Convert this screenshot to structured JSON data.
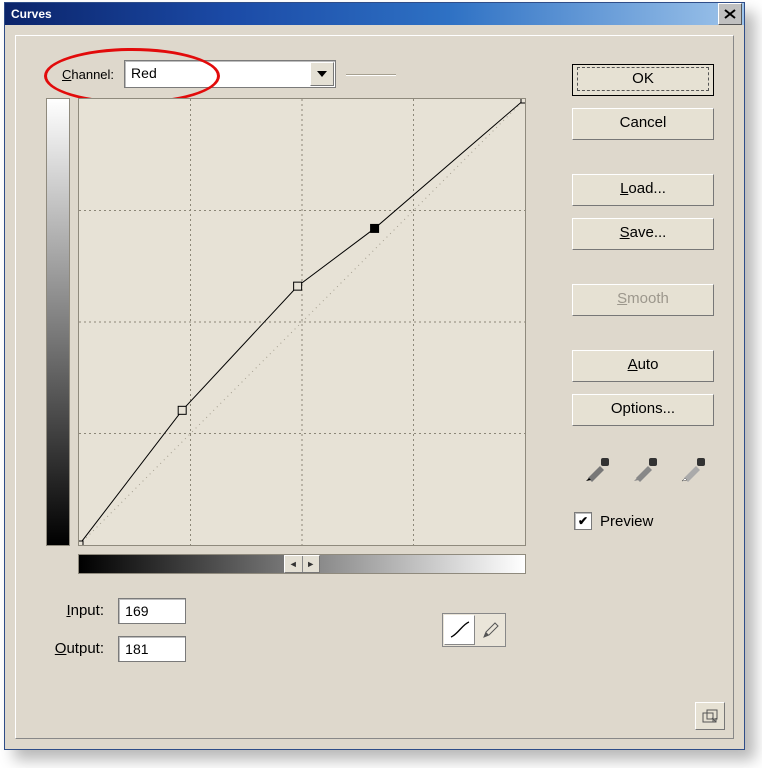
{
  "title": "Curves",
  "channel": {
    "label_pre": "C",
    "label_rest": "hannel:",
    "value": "Red"
  },
  "io": {
    "input_label_pre": "I",
    "input_label_rest": "nput:",
    "input_value": "169",
    "output_label_pre": "O",
    "output_label_rest": "utput:",
    "output_value": "181"
  },
  "buttons": {
    "ok": "OK",
    "cancel": "Cancel",
    "load_pre": "L",
    "load_rest": "oad...",
    "save_pre": "S",
    "save_rest": "ave...",
    "smooth_pre": "S",
    "smooth_rest": "mooth",
    "auto_pre": "A",
    "auto_rest": "uto",
    "options": "Options..."
  },
  "preview": {
    "checked": "✔",
    "label_pre": "P",
    "label_rest": "review"
  },
  "curve": {
    "points": [
      {
        "in": 0,
        "out": 0
      },
      {
        "in": 59,
        "out": 77
      },
      {
        "in": 125,
        "out": 148
      },
      {
        "in": 169,
        "out": 181
      },
      {
        "in": 255,
        "out": 255
      }
    ],
    "selected_index": 3,
    "grid_divisions": 4
  }
}
